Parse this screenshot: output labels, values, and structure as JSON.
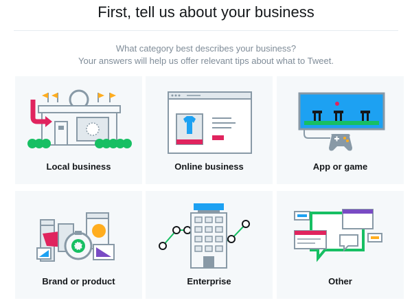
{
  "header": {
    "title": "First, tell us about your business",
    "question": "What category best describes your business?",
    "hint": "Your answers will help us offer relevant tips about what to Tweet."
  },
  "categories": [
    {
      "label": "Local business",
      "icon": "storefront-icon"
    },
    {
      "label": "Online business",
      "icon": "online-store-icon"
    },
    {
      "label": "App or game",
      "icon": "game-controller-icon"
    },
    {
      "label": "Brand or product",
      "icon": "products-icon"
    },
    {
      "label": "Enterprise",
      "icon": "office-building-icon"
    },
    {
      "label": "Other",
      "icon": "speech-bubbles-icon"
    }
  ],
  "colors": {
    "outline": "#8899a6",
    "light_blue": "#e1e8ed",
    "red": "#e0245e",
    "green": "#17bf63",
    "dark_green": "#0d6b3a",
    "blue": "#1da1f2",
    "yellow": "#ffad1f",
    "purple": "#794bc4",
    "card_bg": "#f5f8fa"
  }
}
